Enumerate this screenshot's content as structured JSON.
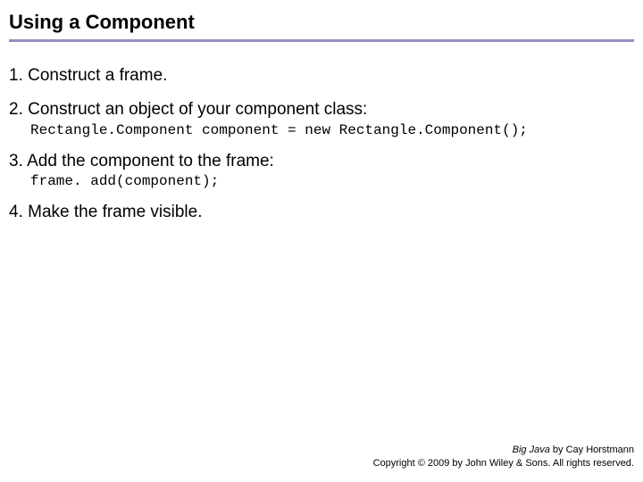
{
  "title": "Using a Component",
  "steps": [
    {
      "num": "1.",
      "text": "Construct a frame.",
      "code": ""
    },
    {
      "num": "2.",
      "text": "Construct an object of your component class:",
      "code": "Rectangle.Component component = new Rectangle.Component();"
    },
    {
      "num": "3.",
      "text": "Add the component to the frame:",
      "code": "frame. add(component);"
    },
    {
      "num": "4.",
      "text": "Make the frame visible.",
      "code": ""
    }
  ],
  "footer": {
    "book": "Big Java",
    "byline": " by Cay Horstmann",
    "copyright": "Copyright © 2009 by John Wiley & Sons.  All rights reserved."
  }
}
